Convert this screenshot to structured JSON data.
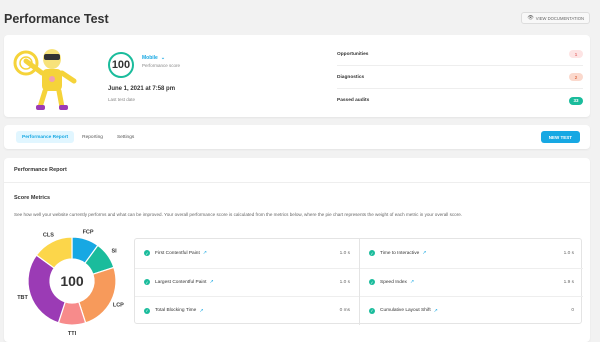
{
  "page": {
    "title": "Performance Test",
    "view_docs": "VIEW DOCUMENTATION",
    "view_docs_icon": "eye-icon"
  },
  "summary": {
    "score": "100",
    "device": "Mobile",
    "device_sub": "Performance score",
    "date": "June 1, 2021 at 7:58 pm",
    "date_sub": "Last test date",
    "stats": [
      {
        "label": "Opportunities",
        "value": "1",
        "color": "#f8a4a4",
        "bg": "#fde4e4"
      },
      {
        "label": "Diagnostics",
        "value": "2",
        "color": "#f08b6c",
        "bg": "#fbd9cd"
      },
      {
        "label": "Passed audits",
        "value": "33",
        "color": "#ffffff",
        "bg": "#1abc9c"
      }
    ]
  },
  "tabs": [
    {
      "label": "Performance Report",
      "active": true
    },
    {
      "label": "Reporting",
      "active": false
    },
    {
      "label": "Settings",
      "active": false
    }
  ],
  "new_test": "NEW TEST",
  "report": {
    "header": "Performance Report",
    "section_title": "Score Metrics",
    "description": "See how well your website currently performs and what can be improved. Your overall performance score is calculated from the metrics below, where the pie chart represents the weight of each metric in your overall score.",
    "pie_score": "100",
    "pie": [
      {
        "label": "FCP",
        "weight": 10,
        "color": "#17a8e3"
      },
      {
        "label": "SI",
        "weight": 10,
        "color": "#1abc9c"
      },
      {
        "label": "LCP",
        "weight": 25,
        "color": "#f79a5b"
      },
      {
        "label": "TTI",
        "weight": 10,
        "color": "#f78b8b"
      },
      {
        "label": "TBT",
        "weight": 30,
        "color": "#9b3bb5"
      },
      {
        "label": "CLS",
        "weight": 15,
        "color": "#fcd64a"
      }
    ],
    "metrics_left": [
      {
        "name": "First Contentful Paint",
        "value": "1.0 s"
      },
      {
        "name": "Largest Contentful Paint",
        "value": "1.0 s"
      },
      {
        "name": "Total Blocking Time",
        "value": "0 ms"
      }
    ],
    "metrics_right": [
      {
        "name": "Time to Interactive",
        "value": "1.0 s"
      },
      {
        "name": "Speed Index",
        "value": "1.9 s"
      },
      {
        "name": "Cumulative Layout Shift",
        "value": "0"
      }
    ]
  }
}
